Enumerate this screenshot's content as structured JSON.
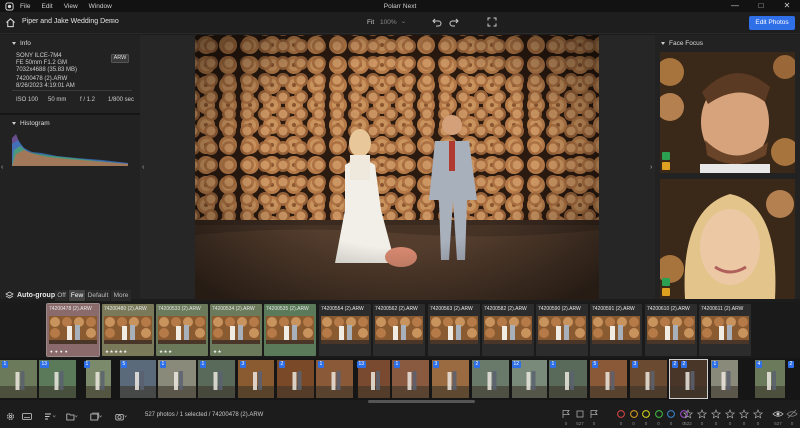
{
  "window": {
    "title": "Polarr Next",
    "menu": [
      "File",
      "Edit",
      "View",
      "Window"
    ],
    "controls": [
      "—",
      "□",
      "✕"
    ]
  },
  "toolbar": {
    "album_title": "Piper and Jake Wedding Demo",
    "fit": "Fit",
    "zoom": "100%",
    "edit_button": "Edit Photos"
  },
  "info": {
    "header": "Info",
    "camera": "SONY ILCE-7M4",
    "lens": "FE 50mm F1.2 GM",
    "dimensions": "7032x4688 (35.83 MB)",
    "file_type": "ARW",
    "filename": "74200478 (2).ARW",
    "datetime": "8/26/2023 4:19:01 AM",
    "iso": "ISO 100",
    "focal": "50 mm",
    "aperture": "f / 1.2",
    "shutter": "1/800 sec"
  },
  "histogram": {
    "header": "Histogram"
  },
  "face_focus": {
    "header": "Face Focus"
  },
  "autogroup": {
    "label": "Auto-group",
    "options": [
      "Off",
      "Few",
      "Default",
      "More"
    ],
    "selected": "Few"
  },
  "groups": [
    {
      "name": "74200478 (2).ARW",
      "stars": "● ● ● ●",
      "tint": "#8a6a6a"
    },
    {
      "name": "74200480 (2).ARW",
      "stars": "★★★★★",
      "tint": "#7a7a5a"
    },
    {
      "name": "74200533 (2).ARW",
      "stars": "★★★",
      "tint": "#6a7a5a"
    },
    {
      "name": "74200534 (2).ARW",
      "stars": "★★",
      "tint": "#6a7a5a"
    },
    {
      "name": "74200535 (2).ARW",
      "stars": "",
      "tint": "#5a7a5a"
    },
    {
      "name": "74200554 (2).ARW",
      "stars": "",
      "tint": ""
    },
    {
      "name": "74200562 (2).ARW",
      "stars": "",
      "tint": ""
    },
    {
      "name": "74200563 (2).ARW",
      "stars": "",
      "tint": ""
    },
    {
      "name": "74200582 (2).ARW",
      "stars": "",
      "tint": ""
    },
    {
      "name": "74200590 (2).ARW",
      "stars": "",
      "tint": ""
    },
    {
      "name": "74200591 (2).ARW",
      "stars": "",
      "tint": ""
    },
    {
      "name": "74200610 (2).ARW",
      "stars": "",
      "tint": ""
    },
    {
      "name": "74200611 (2).ARW",
      "stars": "",
      "tint": ""
    }
  ],
  "filmstrip_counts": [
    "1",
    "13",
    "1",
    "5",
    "1",
    "1",
    "3",
    "2",
    "1",
    "13",
    "1",
    "3",
    "2",
    "12",
    "1",
    "5",
    "3",
    "2",
    "2",
    "1",
    "4",
    "2",
    "1",
    "13",
    "5",
    "3",
    "4",
    "5"
  ],
  "status": {
    "text": "527 photos / 1 selected / 74200478 (2).ARW",
    "flags": [
      "0",
      "527",
      "0"
    ],
    "colors": [
      "0",
      "0",
      "0",
      "0",
      "0",
      "0"
    ],
    "stars": [
      "522",
      "0",
      "0",
      "0",
      "0",
      "0"
    ],
    "views": [
      "527",
      "0"
    ],
    "color_values": [
      "#777777",
      "#e04646",
      "#e0a020",
      "#d8d820",
      "#40c040",
      "#3a8ad8",
      "#a050d0"
    ]
  }
}
